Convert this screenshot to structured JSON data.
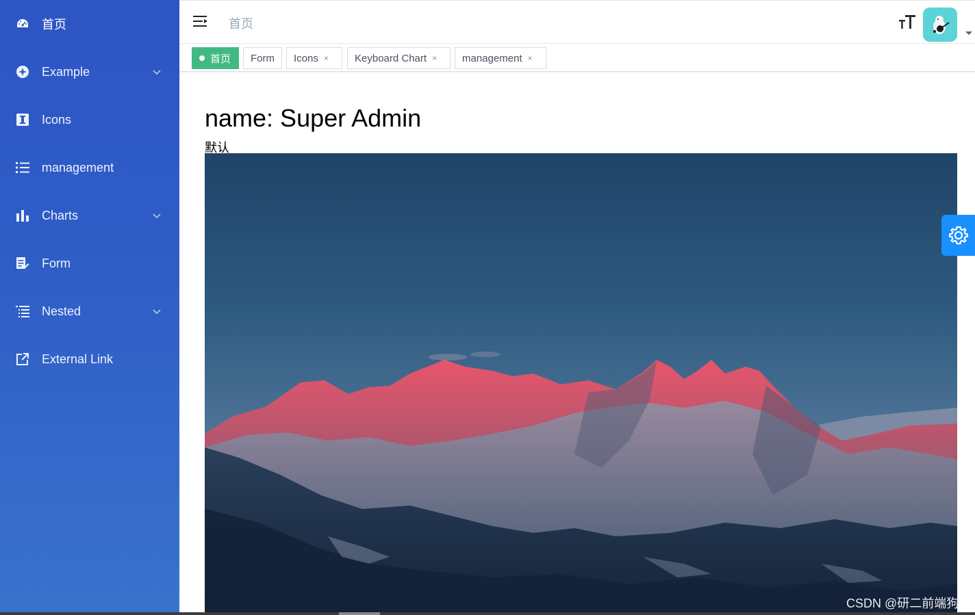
{
  "sidebar": {
    "items": [
      {
        "label": "首页",
        "icon": "dashboard-icon",
        "has_submenu": false
      },
      {
        "label": "Example",
        "icon": "example-icon",
        "has_submenu": true
      },
      {
        "label": "Icons",
        "icon": "icons-icon",
        "has_submenu": false
      },
      {
        "label": "management",
        "icon": "list-icon",
        "has_submenu": false
      },
      {
        "label": "Charts",
        "icon": "chart-icon",
        "has_submenu": true
      },
      {
        "label": "Form",
        "icon": "form-icon",
        "has_submenu": false
      },
      {
        "label": "Nested",
        "icon": "nested-icon",
        "has_submenu": true
      },
      {
        "label": "External Link",
        "icon": "external-link-icon",
        "has_submenu": false
      }
    ]
  },
  "navbar": {
    "breadcrumb": "首页"
  },
  "tags": [
    {
      "label": "首页",
      "active": true,
      "closable": false
    },
    {
      "label": "Form",
      "active": false,
      "closable": false
    },
    {
      "label": "Icons",
      "active": false,
      "closable": true
    },
    {
      "label": "Keyboard Chart",
      "active": false,
      "closable": true
    },
    {
      "label": "management",
      "active": false,
      "closable": true
    }
  ],
  "tag_close_glyph": "×",
  "main": {
    "name_line": "name: Super Admin",
    "role_line": "默认"
  },
  "watermark": "CSDN @研二前端狗",
  "colors": {
    "sidebar_bg": "#2f5ec7",
    "active_tag": "#42b983",
    "settings_button": "#1890ff",
    "avatar_bg": "#5cd3d6"
  }
}
